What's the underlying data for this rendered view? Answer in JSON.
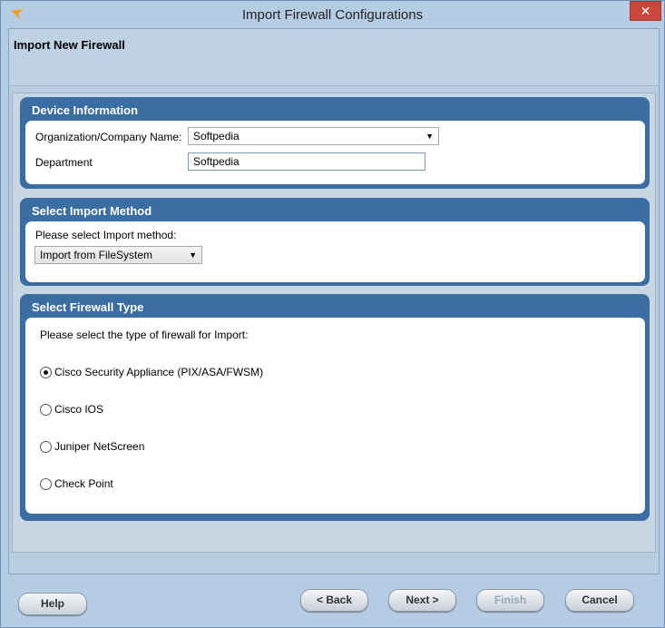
{
  "window": {
    "title": "Import Firewall Configurations",
    "close_label": "✕"
  },
  "page": {
    "title": "Import New Firewall"
  },
  "device_info": {
    "heading": "Device Information",
    "org_label": "Organization/Company Name:",
    "org_value": "Softpedia",
    "dept_label": "Department",
    "dept_value": "Softpedia"
  },
  "import_method": {
    "heading": "Select Import Method",
    "prompt": "Please select Import method:",
    "selected": "Import from FileSystem"
  },
  "firewall_type": {
    "heading": "Select Firewall Type",
    "prompt": "Please select the type of firewall for Import:",
    "options": [
      {
        "label": "Cisco Security Appliance (PIX/ASA/FWSM)",
        "selected": true
      },
      {
        "label": "Cisco IOS",
        "selected": false
      },
      {
        "label": "Juniper NetScreen",
        "selected": false
      },
      {
        "label": "Check Point",
        "selected": false
      }
    ]
  },
  "buttons": {
    "help": "Help",
    "back": "< Back",
    "next": "Next >",
    "finish": "Finish",
    "cancel": "Cancel"
  },
  "colors": {
    "panel": "#3a6da1",
    "background": "#b4cde4"
  }
}
